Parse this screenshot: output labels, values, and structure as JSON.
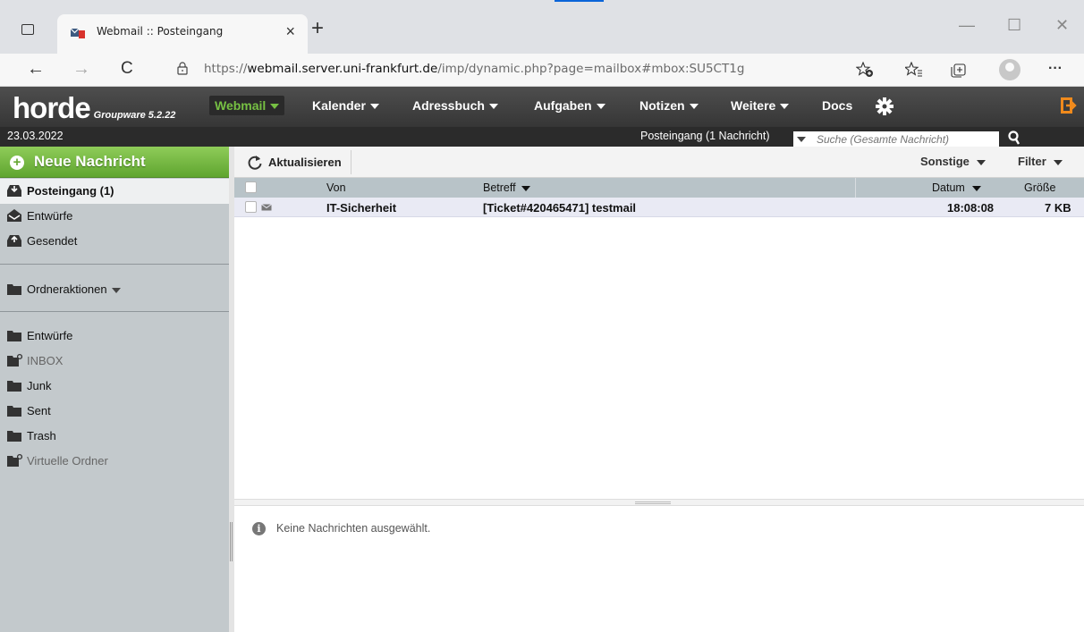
{
  "browser": {
    "tab_title": "Webmail :: Posteingang",
    "tab_close": "×",
    "new_tab": "+",
    "url_prefix": "https://",
    "url_host": "webmail.server.uni-frankfurt.de",
    "url_path": "/imp/dynamic.php?page=mailbox#mbox:SU5CT1g",
    "controls": {
      "back": "←",
      "forward": "→",
      "reload": "C",
      "minimize": "—",
      "maximize": "☐",
      "close": "✕",
      "more": "···"
    }
  },
  "horde": {
    "logo": "horde",
    "version": "Groupware 5.2.22",
    "menu": [
      {
        "label": "Webmail",
        "active": true
      },
      {
        "label": "Kalender"
      },
      {
        "label": "Adressbuch"
      },
      {
        "label": "Aufgaben"
      },
      {
        "label": "Notizen"
      },
      {
        "label": "Weitere"
      },
      {
        "label": "Docs"
      }
    ],
    "date": "23.03.2022",
    "mailbox_status": "Posteingang (1 Nachricht)",
    "search_placeholder": "Suche (Gesamte Nachricht)"
  },
  "sidebar": {
    "new_message": "Neue Nachricht",
    "special_folders": [
      {
        "label": "Posteingang (1)",
        "selected": true
      },
      {
        "label": "Entwürfe"
      },
      {
        "label": "Gesendet"
      }
    ],
    "folder_actions": "Ordneraktionen",
    "folders": [
      {
        "label": "Entwürfe"
      },
      {
        "label": "INBOX",
        "muted": true
      },
      {
        "label": "Junk"
      },
      {
        "label": "Sent"
      },
      {
        "label": "Trash"
      },
      {
        "label": "Virtuelle Ordner",
        "muted": true
      }
    ]
  },
  "toolbar": {
    "refresh": "Aktualisieren",
    "other": "Sonstige",
    "filter": "Filter"
  },
  "list": {
    "columns": {
      "from": "Von",
      "subject": "Betreff",
      "date": "Datum",
      "size": "Größe"
    },
    "rows": [
      {
        "from": "IT-Sicherheit",
        "subject": "[Ticket#420465471] testmail",
        "date": "18:08:08",
        "size": "7 KB"
      }
    ]
  },
  "preview": {
    "empty_text": "Keine Nachrichten ausgewählt."
  },
  "colors": {
    "horde_bar": "#3f3f3f",
    "active_green": "#76c043",
    "new_message_green": "#6bb13a",
    "sidebar_bg": "#c3c9cc",
    "list_header": "#b8c3c8",
    "row_unread": "#e9eaf4"
  }
}
